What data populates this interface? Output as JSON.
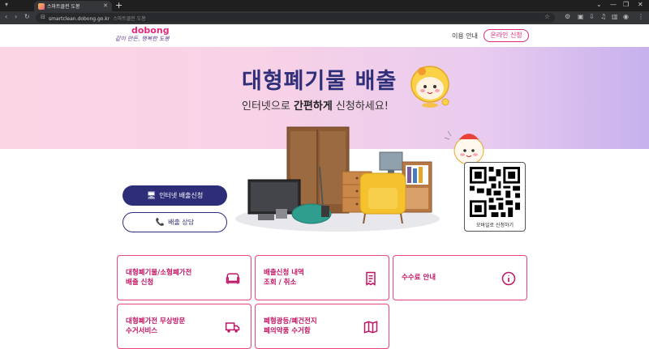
{
  "browser": {
    "tab_title": "스마트클린 도봉",
    "url": "smartclean.dobong.go.kr",
    "page_title": "스마트클린 도봉"
  },
  "header": {
    "brand": "dobong",
    "slogan": "같이 만든, 행복한 도봉",
    "guide_label": "이용 안내",
    "apply_label": "온라인 신청"
  },
  "hero": {
    "title": "대형폐기물 배출",
    "subtitle_pre": "인터넷으로 ",
    "subtitle_bold": "간편하게",
    "subtitle_post": " 신청하세요!"
  },
  "actions": {
    "internet_label": "인터넷 배출신청",
    "call_label": "배출 상담"
  },
  "qr": {
    "label": "모바일로 신청하기"
  },
  "cards": [
    {
      "label": "대형폐기물/소형폐가전\n배출 신청",
      "icon": "sofa-icon"
    },
    {
      "label": "배출신청 내역\n조회 / 취소",
      "icon": "receipt-icon"
    },
    {
      "label": "수수료 안내",
      "icon": "info-icon"
    },
    {
      "label": "대형폐가전 무상방문\n수거서비스",
      "icon": "truck-icon"
    },
    {
      "label": "폐형광등/폐건전지\n폐의약품 수거함",
      "icon": "map-icon"
    }
  ],
  "colors": {
    "accent": "#e4287a",
    "navy": "#2e2d78"
  }
}
